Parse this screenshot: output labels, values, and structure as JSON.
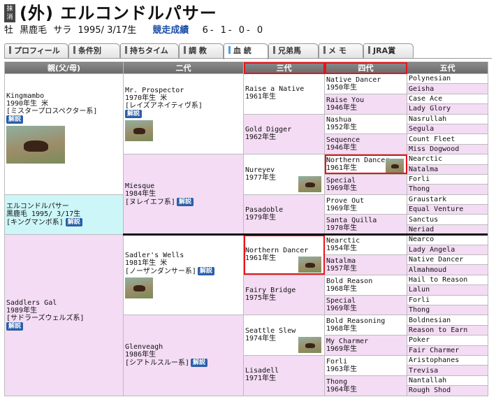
{
  "header": {
    "mark_top": "抹",
    "mark_bottom": "消",
    "title": "(外) エルコンドルパサー",
    "sex": "牡",
    "color": "黒鹿毛",
    "breed": "サラ",
    "birth": "1995/ 3/17生",
    "race_link": "競走成績",
    "record": "6- 1- 0- 0"
  },
  "tabs": [
    {
      "label": "プロフィール"
    },
    {
      "label": "条件別"
    },
    {
      "label": "持ちタイム"
    },
    {
      "label": "調 教"
    },
    {
      "label": "血 統",
      "active": true
    },
    {
      "label": "兄弟馬"
    },
    {
      "label": "メ モ"
    },
    {
      "label": "JRA賞"
    }
  ],
  "columns": [
    "親(父/母)",
    "二代",
    "三代",
    "四代",
    "五代"
  ],
  "kaisetsu": "解説",
  "gen1": {
    "sire": {
      "name": "Kingmambo",
      "info": "1990年生 米",
      "line": "[ミスタープロスペクター系]"
    },
    "self": {
      "name": "エルコンドルパサー",
      "info": "黒鹿毛 1995/ 3/17生",
      "line": "[キングマンボ系]"
    },
    "dam": {
      "name": "Saddlers Gal",
      "info": "1989年生",
      "line": "[サドラーズウェルズ系]"
    }
  },
  "gen2": [
    {
      "name": "Mr. Prospector",
      "info": "1970年生 米",
      "line": "[レイズアネイティヴ系]"
    },
    {
      "name": "Miesque",
      "info": "1984年生",
      "line": "[ヌレイエフ系]"
    },
    {
      "name": "Sadler's Wells",
      "info": "1981年生 米",
      "line": "[ノーザンダンサー系]"
    },
    {
      "name": "Glenveagh",
      "info": "1986年生",
      "line": "[シアトルスルー系]"
    }
  ],
  "gen3": [
    {
      "name": "Raise a Native",
      "info": "1961年生"
    },
    {
      "name": "Gold Digger",
      "info": "1962年生"
    },
    {
      "name": "Nureyev",
      "info": "1977年生"
    },
    {
      "name": "Pasadoble",
      "info": "1979年生"
    },
    {
      "name": "Northern Dancer",
      "info": "1961年生"
    },
    {
      "name": "Fairy Bridge",
      "info": "1975年生"
    },
    {
      "name": "Seattle Slew",
      "info": "1974年生"
    },
    {
      "name": "Lisadell",
      "info": "1971年生"
    }
  ],
  "gen4": [
    {
      "name": "Native Dancer",
      "info": "1950年生"
    },
    {
      "name": "Raise You",
      "info": "1946年生"
    },
    {
      "name": "Nashua",
      "info": "1952年生"
    },
    {
      "name": "Sequence",
      "info": "1946年生"
    },
    {
      "name": "Northern Dancer",
      "info": "1961年生"
    },
    {
      "name": "Special",
      "info": "1969年生"
    },
    {
      "name": "Prove Out",
      "info": "1969年生"
    },
    {
      "name": "Santa Quilla",
      "info": "1970年生"
    },
    {
      "name": "Nearctic",
      "info": "1954年生"
    },
    {
      "name": "Natalma",
      "info": "1957年生"
    },
    {
      "name": "Bold Reason",
      "info": "1968年生"
    },
    {
      "name": "Special",
      "info": "1969年生"
    },
    {
      "name": "Bold Reasoning",
      "info": "1968年生"
    },
    {
      "name": "My Charmer",
      "info": "1969年生"
    },
    {
      "name": "Forli",
      "info": "1963年生"
    },
    {
      "name": "Thong",
      "info": "1964年生"
    }
  ],
  "gen5": [
    "Polynesian",
    "Geisha",
    "Case Ace",
    "Lady Glory",
    "Nasrullah",
    "Segula",
    "Count Fleet",
    "Miss Dogwood",
    "Nearctic",
    "Natalma",
    "Forli",
    "Thong",
    "Graustark",
    "Equal Venture",
    "Sanctus",
    "Neriad",
    "Nearco",
    "Lady Angela",
    "Native Dancer",
    "Almahmoud",
    "Hail to Reason",
    "Lalun",
    "Forli",
    "Thong",
    "Boldnesian",
    "Reason to Earn",
    "Poker",
    "Fair Charmer",
    "Aristophanes",
    "Trevisa",
    "Nantallah",
    "Rough Shod"
  ],
  "colors": {
    "highlight": "#e8121c",
    "female_bg": "#f4dcf4",
    "self_bg": "#ccf6f8",
    "link": "#1a4ea8"
  }
}
